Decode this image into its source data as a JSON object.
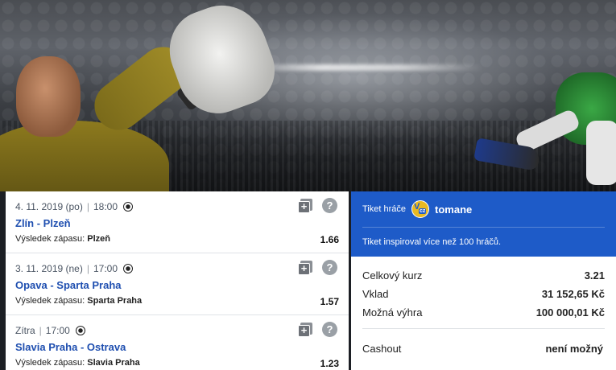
{
  "matches": [
    {
      "date": "4. 11. 2019 (po)",
      "time": "18:00",
      "teams": "Zlín - Plzeň",
      "result_label": "Výsledek zápasu:",
      "result_value": "Plzeň",
      "odd": "1.66"
    },
    {
      "date": "3. 11. 2019 (ne)",
      "time": "17:00",
      "teams": "Opava - Sparta Praha",
      "result_label": "Výsledek zápasu:",
      "result_value": "Sparta Praha",
      "odd": "1.57"
    },
    {
      "date": "Zítra",
      "time": "17:00",
      "teams": "Slavia Praha - Ostrava",
      "result_label": "Výsledek zápasu:",
      "result_value": "Slavia Praha",
      "odd": "1.23"
    }
  ],
  "icons": {
    "sport": "soccer-ball-icon",
    "add": "add-to-ticket-icon",
    "help": "help-icon",
    "add_glyph": "+",
    "help_glyph": "?"
  },
  "ticket": {
    "player_label": "Tiket hráče",
    "player_name": "tomane",
    "avatar_text_v": "V",
    "avatar_text_cz": "cz",
    "inspired_text": "Tiket inspiroval více než 100 hráčů.",
    "total_odds_label": "Celkový kurz",
    "total_odds_value": "3.21",
    "stake_label": "Vklad",
    "stake_value": "31 152,65 Kč",
    "win_label": "Možná výhra",
    "win_value": "100 000,01 Kč",
    "cashout_label": "Cashout",
    "cashout_value": "není možný"
  },
  "colors": {
    "accent_blue": "#1e5bc8",
    "team_link": "#1f4fb0"
  }
}
